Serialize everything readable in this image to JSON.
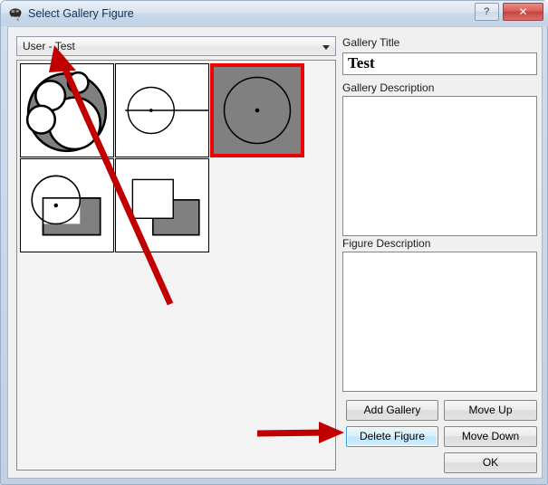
{
  "window": {
    "title": "Select Gallery Figure",
    "icon": "gallery-app-icon",
    "caption_buttons": [
      {
        "name": "help-button",
        "glyph": "?"
      },
      {
        "name": "close-button",
        "glyph": "✕"
      }
    ]
  },
  "gallery_selector": {
    "selected_value": "User - Test",
    "arrow_icon": "chevron-down-icon"
  },
  "thumbnails": [
    {
      "index": 0,
      "name": "figure-thumbnail-apollonian-circles",
      "selected": false
    },
    {
      "index": 1,
      "name": "figure-thumbnail-circle-with-diameter-line",
      "selected": false
    },
    {
      "index": 2,
      "name": "figure-thumbnail-filled-circle",
      "selected": true
    },
    {
      "index": 3,
      "name": "figure-thumbnail-circle-and-rectangle",
      "selected": false
    },
    {
      "index": 4,
      "name": "figure-thumbnail-two-rectangles",
      "selected": false
    }
  ],
  "fields": {
    "gallery_title_label": "Gallery Title",
    "gallery_title_value": "Test",
    "gallery_description_label": "Gallery Description",
    "gallery_description_value": "",
    "figure_description_label": "Figure Description",
    "figure_description_value": ""
  },
  "buttons": {
    "add_gallery": "Add Gallery",
    "move_up": "Move Up",
    "delete_figure": "Delete Figure",
    "move_down": "Move Down",
    "ok": "OK"
  },
  "annotations": {
    "arrow_color": "#c00000",
    "arrow_to_gallery_selector": "arrow pointing to gallery dropdown",
    "arrow_to_delete_figure": "arrow pointing to Delete Figure button"
  }
}
